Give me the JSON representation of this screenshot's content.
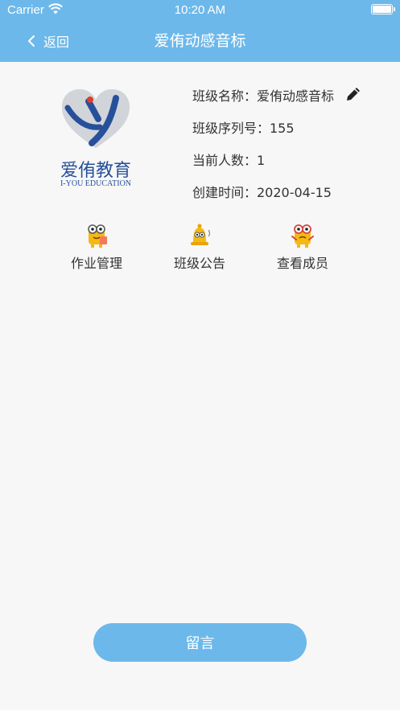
{
  "status_bar": {
    "carrier": "Carrier",
    "time": "10:20 AM"
  },
  "nav": {
    "back_label": "返回",
    "title": "爱侑动感音标"
  },
  "logo": {
    "name": "爱侑教育",
    "subtitle": "I-YOU EDUCATION",
    "brand_color": "#27509a"
  },
  "class_info": {
    "name": "班级名称：爱侑动感音标",
    "serial": "班级序列号：155",
    "member_count": "当前人数：1",
    "created": "创建时间：2020-04-15"
  },
  "actions": [
    {
      "label": "作业管理",
      "icon": "homework-character-icon"
    },
    {
      "label": "班级公告",
      "icon": "bell-character-icon"
    },
    {
      "label": "查看成员",
      "icon": "members-character-icon"
    }
  ],
  "bottom_button": {
    "label": "留言"
  },
  "colors": {
    "accent": "#6db8ea",
    "background": "#f7f7f7",
    "text": "#333333"
  }
}
